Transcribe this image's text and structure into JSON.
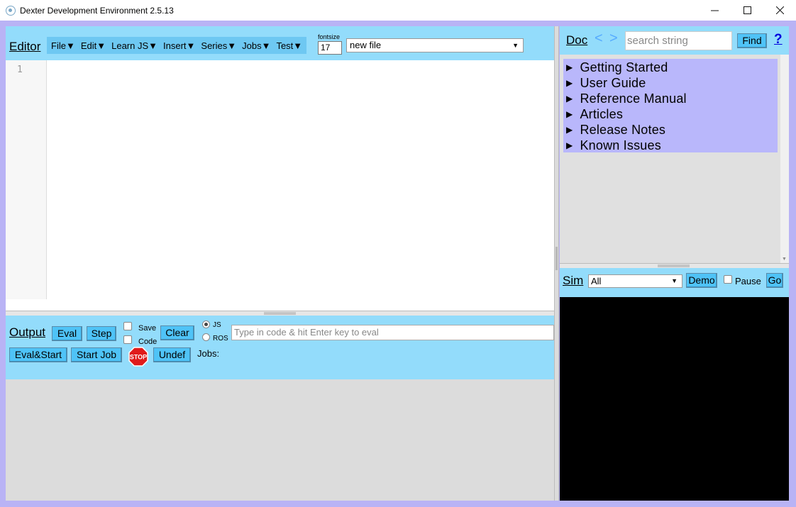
{
  "window": {
    "title": "Dexter Development Environment 2.5.13"
  },
  "editor": {
    "title": "Editor",
    "menus": [
      "File▼",
      "Edit▼",
      "Learn JS▼",
      "Insert▼",
      "Series▼",
      "Jobs▼",
      "Test▼"
    ],
    "fontsize_label": "fontsize",
    "fontsize_value": "17",
    "file_select": "new file",
    "line_numbers": [
      "1"
    ]
  },
  "output": {
    "title": "Output",
    "eval_label": "Eval",
    "step_label": "Step",
    "save_label": "Save",
    "code_label": "Code",
    "clear_label": "Clear",
    "radio_js": "JS",
    "radio_ros": "ROS",
    "radio_selected": "JS",
    "eval_placeholder": "Type in code & hit Enter key to eval",
    "eval_start_label": "Eval&Start",
    "start_job_label": "Start Job",
    "stop_label": "STOP",
    "undef_label": "Undef",
    "jobs_label": "Jobs:"
  },
  "doc": {
    "title": "Doc",
    "back_arrow": "<",
    "forward_arrow": ">",
    "search_placeholder": "search string",
    "find_label": "Find",
    "help_label": "?",
    "items": [
      {
        "label": "Getting Started"
      },
      {
        "label": "User Guide"
      },
      {
        "label": "Reference Manual"
      },
      {
        "label": "Articles"
      },
      {
        "label": "Release Notes"
      },
      {
        "label": "Known Issues"
      }
    ]
  },
  "sim": {
    "title": "Sim",
    "select_value": "All",
    "demo_label": "Demo",
    "pause_label": "Pause",
    "go_label": "Go"
  },
  "colors": {
    "header_blue": "#93dcfb",
    "button_blue": "#4fc3f7",
    "doc_list_purple": "#b9b7fb",
    "frame_purple": "#b9b3f5",
    "stop_red": "#e01b1b"
  }
}
